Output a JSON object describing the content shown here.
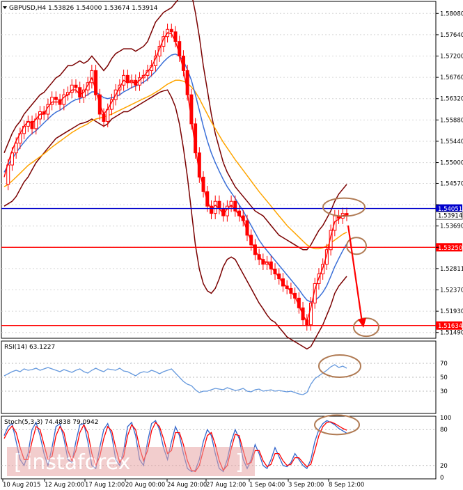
{
  "header": {
    "symbol_line": "GBPUSD,H4  1.53826 1.54000 1.53674 1.53914"
  },
  "watermark": "instaforex",
  "colors": {
    "candle": "#ff0000",
    "bollinger": "#7a0000",
    "ma_fast": "#ff0000",
    "ma_mid": "#3a6fd8",
    "ma_slow": "#ffa500",
    "resistance": "#0000cc",
    "support": "#ff0000",
    "rsi": "#6699dd",
    "stoch_main": "#3366cc",
    "stoch_signal": "#ff0000",
    "ellipse": "#b07b54",
    "arrow": "#ff0000"
  },
  "chart_data": [
    {
      "type": "candlestick",
      "panel": "price",
      "title": "GBPUSD,H4",
      "ohlc": {
        "open": 1.53826,
        "high": 1.54,
        "low": 1.53674,
        "close": 1.53914
      },
      "ylim": [
        1.514,
        1.583
      ],
      "y_ticks": [
        "1.58080",
        "1.57640",
        "1.57200",
        "1.56760",
        "1.56320",
        "1.55880",
        "1.55440",
        "1.55000",
        "1.54570",
        "1.54130",
        "1.53690",
        "1.53250",
        "1.52811",
        "1.52370",
        "1.51930",
        "1.51490"
      ],
      "x_ticks": [
        "10 Aug 2015",
        "12 Aug 20:00",
        "17 Aug 12:00",
        "20 Aug 00:00",
        "24 Aug 20:00",
        "27 Aug 12:00",
        "1 Sep 04:00",
        "3 Sep 20:00",
        "8 Sep 12:00"
      ],
      "levels": [
        {
          "name": "resistance",
          "value": 1.54051,
          "label": "1.54051"
        },
        {
          "name": "support",
          "value": 1.5325,
          "label": "1.53250"
        },
        {
          "name": "support",
          "value": 1.51634,
          "label": "1.51634"
        }
      ],
      "current_price_label": "1.53914",
      "closes": [
        1.5455,
        1.5495,
        1.552,
        1.554,
        1.556,
        1.5575,
        1.5585,
        1.557,
        1.559,
        1.5605,
        1.56,
        1.562,
        1.5635,
        1.563,
        1.562,
        1.564,
        1.5645,
        1.566,
        1.5655,
        1.5635,
        1.565,
        1.5665,
        1.569,
        1.564,
        1.56,
        1.5585,
        1.561,
        1.563,
        1.565,
        1.566,
        1.568,
        1.5665,
        1.567,
        1.566,
        1.5675,
        1.568,
        1.569,
        1.57,
        1.572,
        1.574,
        1.576,
        1.5775,
        1.577,
        1.575,
        1.572,
        1.569,
        1.564,
        1.558,
        1.552,
        1.547,
        1.544,
        1.541,
        1.5395,
        1.542,
        1.5405,
        1.539,
        1.541,
        1.542,
        1.54,
        1.539,
        1.538,
        1.535,
        1.533,
        1.531,
        1.53,
        1.529,
        1.5295,
        1.528,
        1.527,
        1.526,
        1.5245,
        1.524,
        1.523,
        1.522,
        1.52,
        1.5175,
        1.5165,
        1.521,
        1.525,
        1.527,
        1.529,
        1.532,
        1.536,
        1.539,
        1.5385,
        1.5395,
        1.5391
      ],
      "bollinger_upper": [
        1.552,
        1.554,
        1.556,
        1.5575,
        1.5585,
        1.56,
        1.561,
        1.562,
        1.563,
        1.564,
        1.5645,
        1.5655,
        1.5665,
        1.5675,
        1.568,
        1.569,
        1.57,
        1.57,
        1.5705,
        1.571,
        1.5705,
        1.571,
        1.572,
        1.571,
        1.57,
        1.569,
        1.57,
        1.5715,
        1.5725,
        1.573,
        1.5735,
        1.5735,
        1.5735,
        1.573,
        1.5735,
        1.574,
        1.575,
        1.577,
        1.579,
        1.58,
        1.581,
        1.5815,
        1.582,
        1.583,
        1.584,
        1.585,
        1.586,
        1.585,
        1.581,
        1.576,
        1.57,
        1.565,
        1.56,
        1.556,
        1.553,
        1.55,
        1.548,
        1.5465,
        1.545,
        1.544,
        1.543,
        1.542,
        1.541,
        1.54,
        1.5395,
        1.539,
        1.538,
        1.537,
        1.536,
        1.535,
        1.5345,
        1.534,
        1.5335,
        1.533,
        1.5325,
        1.532,
        1.532,
        1.533,
        1.5345,
        1.536,
        1.537,
        1.5385,
        1.54,
        1.542,
        1.5435,
        1.5445,
        1.5455
      ],
      "bollinger_lower": [
        1.541,
        1.5415,
        1.542,
        1.543,
        1.5445,
        1.546,
        1.547,
        1.5485,
        1.55,
        1.551,
        1.552,
        1.553,
        1.554,
        1.555,
        1.5555,
        1.556,
        1.5565,
        1.557,
        1.5575,
        1.558,
        1.5582,
        1.5585,
        1.559,
        1.5585,
        1.558,
        1.5575,
        1.558,
        1.559,
        1.5595,
        1.56,
        1.5605,
        1.5605,
        1.561,
        1.5615,
        1.562,
        1.5625,
        1.563,
        1.5635,
        1.564,
        1.5645,
        1.5648,
        1.565,
        1.5635,
        1.5615,
        1.558,
        1.553,
        1.547,
        1.54,
        1.533,
        1.528,
        1.525,
        1.5235,
        1.523,
        1.524,
        1.526,
        1.5285,
        1.53,
        1.5305,
        1.53,
        1.5285,
        1.527,
        1.5255,
        1.524,
        1.5225,
        1.521,
        1.5198,
        1.5185,
        1.5175,
        1.517,
        1.516,
        1.515,
        1.514,
        1.5135,
        1.513,
        1.5125,
        1.512,
        1.5115,
        1.512,
        1.5135,
        1.515,
        1.5165,
        1.5185,
        1.5205,
        1.523,
        1.5245,
        1.5255,
        1.5265
      ],
      "ma_fast": [
        1.547,
        1.55,
        1.5525,
        1.5545,
        1.556,
        1.5575,
        1.5585,
        1.558,
        1.559,
        1.56,
        1.56,
        1.5615,
        1.5625,
        1.5625,
        1.5625,
        1.5635,
        1.564,
        1.565,
        1.565,
        1.564,
        1.5645,
        1.566,
        1.5675,
        1.565,
        1.562,
        1.56,
        1.561,
        1.5625,
        1.564,
        1.5655,
        1.567,
        1.5665,
        1.5668,
        1.5662,
        1.567,
        1.5678,
        1.5688,
        1.5698,
        1.5715,
        1.5735,
        1.5755,
        1.5768,
        1.5766,
        1.575,
        1.5725,
        1.5692,
        1.5645,
        1.559,
        1.553,
        1.548,
        1.545,
        1.542,
        1.5403,
        1.5412,
        1.5405,
        1.5394,
        1.5404,
        1.5412,
        1.5402,
        1.5392,
        1.5382,
        1.5358,
        1.5338,
        1.5318,
        1.5306,
        1.5296,
        1.5294,
        1.5284,
        1.5274,
        1.5263,
        1.525,
        1.5243,
        1.5233,
        1.5223,
        1.5205,
        1.5185,
        1.5172,
        1.52,
        1.5238,
        1.5262,
        1.5282,
        1.531,
        1.5348,
        1.5378,
        1.5383,
        1.5391,
        1.5391
      ],
      "ma_mid": [
        1.548,
        1.5495,
        1.5508,
        1.552,
        1.5532,
        1.5542,
        1.5552,
        1.556,
        1.5566,
        1.5574,
        1.5582,
        1.559,
        1.5598,
        1.5604,
        1.5608,
        1.5614,
        1.562,
        1.5626,
        1.563,
        1.5632,
        1.5636,
        1.564,
        1.5646,
        1.5646,
        1.564,
        1.5634,
        1.5632,
        1.5634,
        1.5636,
        1.564,
        1.5646,
        1.565,
        1.5655,
        1.5658,
        1.5662,
        1.5666,
        1.5672,
        1.568,
        1.5688,
        1.5698,
        1.5708,
        1.5716,
        1.5722,
        1.5724,
        1.572,
        1.571,
        1.5692,
        1.567,
        1.564,
        1.5608,
        1.5575,
        1.5545,
        1.552,
        1.55,
        1.5482,
        1.5465,
        1.545,
        1.5438,
        1.5426,
        1.5413,
        1.54,
        1.5385,
        1.537,
        1.5355,
        1.534,
        1.5328,
        1.5318,
        1.5308,
        1.5298,
        1.5288,
        1.5278,
        1.5268,
        1.5258,
        1.5248,
        1.5238,
        1.5226,
        1.5216,
        1.5212,
        1.5215,
        1.5222,
        1.5232,
        1.5246,
        1.5265,
        1.5285,
        1.5302,
        1.5318,
        1.5332
      ],
      "ma_slow": [
        1.545,
        1.5455,
        1.5462,
        1.547,
        1.5478,
        1.5486,
        1.5494,
        1.55,
        1.5506,
        1.5512,
        1.5518,
        1.5525,
        1.5532,
        1.5538,
        1.5544,
        1.555,
        1.5556,
        1.5562,
        1.5567,
        1.5572,
        1.5576,
        1.558,
        1.5586,
        1.559,
        1.5592,
        1.5594,
        1.5597,
        1.56,
        1.5604,
        1.5608,
        1.5612,
        1.5616,
        1.562,
        1.5624,
        1.5628,
        1.5632,
        1.5636,
        1.564,
        1.5645,
        1.565,
        1.5656,
        1.5662,
        1.5666,
        1.567,
        1.567,
        1.5668,
        1.5664,
        1.5656,
        1.5646,
        1.5632,
        1.5616,
        1.56,
        1.5584,
        1.557,
        1.5556,
        1.5542,
        1.553,
        1.5518,
        1.5506,
        1.5495,
        1.5484,
        1.5473,
        1.5462,
        1.5451,
        1.544,
        1.543,
        1.542,
        1.541,
        1.54,
        1.539,
        1.538,
        1.537,
        1.5362,
        1.5354,
        1.5346,
        1.5338,
        1.533,
        1.5325,
        1.5322,
        1.5322,
        1.5324,
        1.5328,
        1.5334,
        1.534,
        1.5346,
        1.5352,
        1.5356
      ]
    },
    {
      "type": "line",
      "panel": "rsi",
      "title": "RSI(14) 63.1227",
      "ylim": [
        0,
        100
      ],
      "y_ticks": [
        "70",
        "50",
        "30"
      ],
      "values": [
        52,
        55,
        58,
        60,
        58,
        62,
        60,
        61,
        63,
        60,
        62,
        64,
        62,
        60,
        58,
        61,
        59,
        57,
        60,
        62,
        58,
        56,
        60,
        63,
        60,
        58,
        62,
        61,
        60,
        63,
        59,
        58,
        55,
        52,
        56,
        58,
        57,
        60,
        58,
        55,
        58,
        60,
        62,
        56,
        50,
        44,
        40,
        38,
        32,
        28,
        30,
        30,
        32,
        34,
        33,
        32,
        35,
        33,
        31,
        32,
        34,
        30,
        29,
        32,
        33,
        30,
        31,
        32,
        30,
        31,
        30,
        29,
        30,
        28,
        26,
        25,
        28,
        40,
        48,
        52,
        56,
        60,
        65,
        68,
        64,
        66,
        63
      ]
    },
    {
      "type": "line",
      "panel": "stochastic",
      "title": "Stoch(5,3,3) 74.4838 79.0942",
      "ylim": [
        0,
        100
      ],
      "y_ticks": [
        "100",
        "80",
        "20",
        "0"
      ],
      "series": [
        {
          "values": [
            70,
            85,
            90,
            60,
            30,
            20,
            40,
            80,
            92,
            70,
            40,
            20,
            50,
            85,
            90,
            65,
            30,
            25,
            60,
            88,
            90,
            60,
            20,
            15,
            50,
            80,
            90,
            70,
            30,
            20,
            45,
            85,
            92,
            70,
            30,
            20,
            60,
            90,
            95,
            80,
            50,
            30,
            60,
            85,
            70,
            40,
            15,
            10,
            12,
            30,
            60,
            80,
            70,
            40,
            15,
            10,
            30,
            60,
            80,
            65,
            30,
            15,
            30,
            55,
            40,
            20,
            15,
            30,
            50,
            35,
            20,
            18,
            25,
            40,
            30,
            20,
            15,
            30,
            60,
            80,
            90,
            95,
            92,
            88,
            82,
            78,
            74
          ]
        },
        {
          "values": [
            65,
            78,
            86,
            75,
            50,
            30,
            30,
            60,
            85,
            80,
            55,
            30,
            35,
            70,
            85,
            75,
            45,
            28,
            45,
            75,
            88,
            75,
            40,
            20,
            35,
            65,
            85,
            78,
            50,
            25,
            35,
            70,
            88,
            80,
            50,
            28,
            45,
            78,
            92,
            85,
            65,
            40,
            45,
            75,
            75,
            55,
            28,
            12,
            10,
            20,
            45,
            70,
            75,
            55,
            28,
            12,
            20,
            48,
            72,
            70,
            45,
            22,
            25,
            45,
            45,
            28,
            18,
            22,
            40,
            40,
            28,
            20,
            22,
            33,
            33,
            25,
            18,
            22,
            45,
            70,
            85,
            92,
            93,
            90,
            86,
            82,
            79
          ]
        }
      ]
    }
  ]
}
